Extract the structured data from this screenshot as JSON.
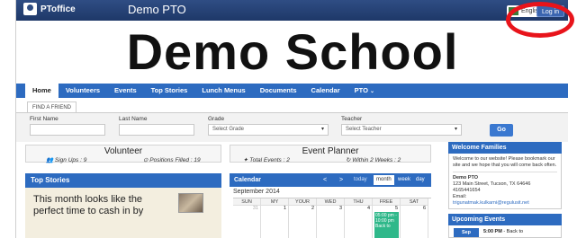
{
  "topbar": {
    "brand": "PToffice",
    "site_title": "Demo PTO",
    "language_label": "English",
    "login_label": "Log in"
  },
  "banner": {
    "title": "Demo School"
  },
  "nav": {
    "items": [
      "Home",
      "Volunteers",
      "Events",
      "Top Stories",
      "Lunch Menus",
      "Documents",
      "Calendar",
      "PTO"
    ],
    "active": "Home"
  },
  "find_friend": {
    "tab_label": "FIND A FRIEND",
    "first_name_label": "First Name",
    "last_name_label": "Last Name",
    "grade_label": "Grade",
    "grade_placeholder": "Select Grade",
    "teacher_label": "Teacher",
    "teacher_placeholder": "Select Teacher",
    "go_label": "Go"
  },
  "volunteer": {
    "title": "Volunteer",
    "sign_ups": "Sign Ups : 9",
    "positions_filled": "Positions Filled : 19"
  },
  "event_planner": {
    "title": "Event Planner",
    "total_events": "Total Events : 2",
    "within_two_weeks": "Within 2 Weeks : 2"
  },
  "top_stories": {
    "title": "Top Stories",
    "story_text": "This month looks like the perfect time to cash in by"
  },
  "calendar": {
    "title": "Calendar",
    "prev": "<",
    "next": ">",
    "today": "today",
    "views": [
      "month",
      "week",
      "day"
    ],
    "selected_view": "month",
    "month_label": "September 2014",
    "weekdays": [
      "SUN",
      "MY",
      "YOUR",
      "WED",
      "THU",
      "FREE",
      "SAT"
    ],
    "first_row": [
      "31",
      "1",
      "2",
      "3",
      "4",
      "5",
      "6"
    ],
    "event_text": "05:00 pm - 10:00 pm Back to"
  },
  "welcome": {
    "title": "Welcome Families",
    "message": "Welcome to our website! Please bookmark our site and we hope that you will come back often.",
    "org_name": "Demo PTO",
    "address": "123 Main Street, Tucson, TX 64646",
    "phone": "4165441654",
    "email_label": "Email:",
    "email": "trigunatmak.kulkarni@regulusit.net"
  },
  "upcoming": {
    "title": "Upcoming Events",
    "date": "Sep",
    "event": "5:00 PM",
    "event_suffix": " - Back to"
  },
  "colors": {
    "topbar": "#1e3868",
    "nav": "#2d6bc0",
    "annotation": "#e8141b",
    "event": "#2fb88a"
  }
}
